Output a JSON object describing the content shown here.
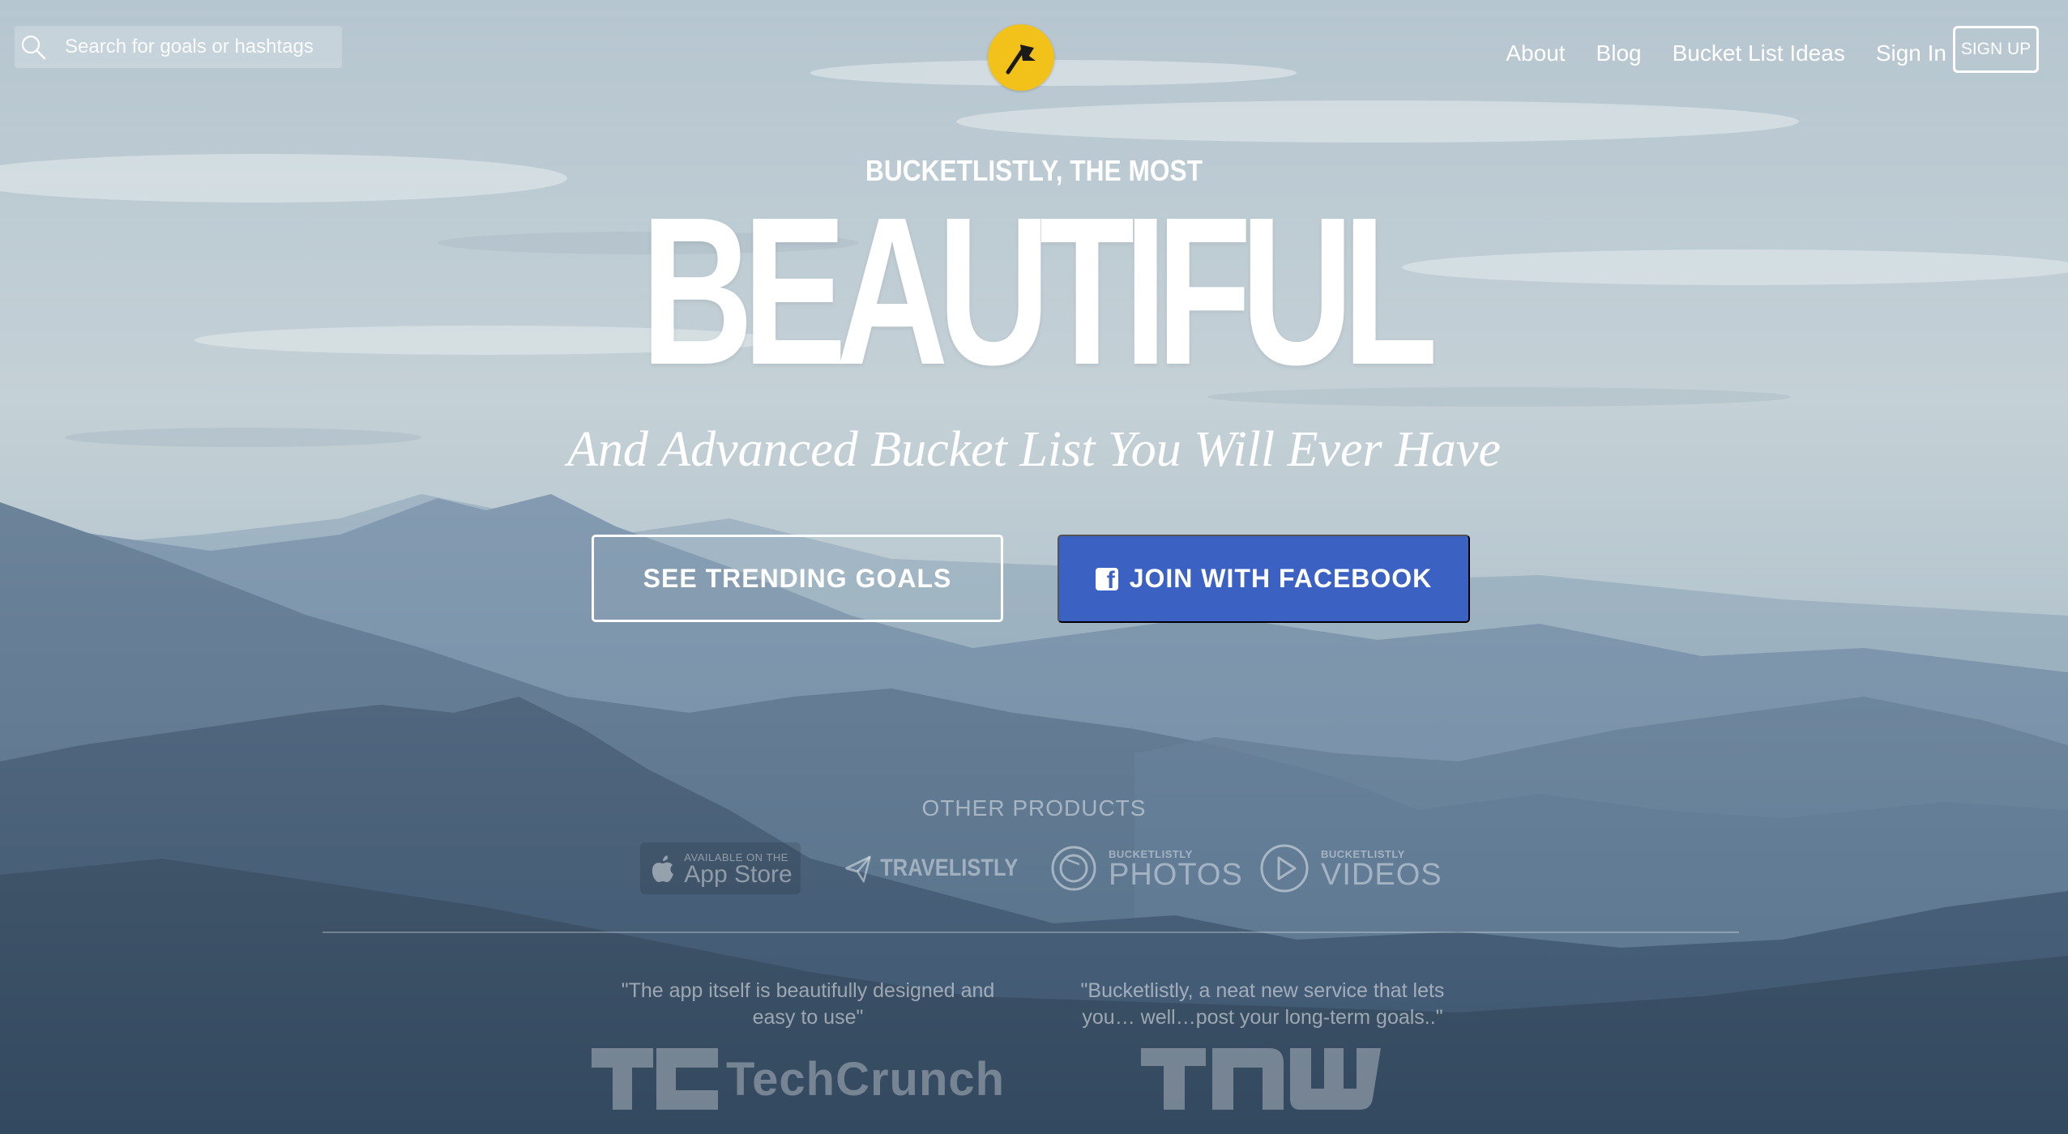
{
  "header": {
    "search_placeholder": "Search for goals or hashtags",
    "nav": [
      "About",
      "Blog",
      "Bucket List Ideas",
      "Sign In"
    ],
    "signup_label": "SIGN UP"
  },
  "hero": {
    "eyebrow": "BUCKETLISTLY, THE MOST",
    "headline": "BEAUTIFUL",
    "tagline": "And Advanced Bucket List You Will Ever Have",
    "trending_button": "SEE TRENDING GOALS",
    "facebook_button": "JOIN WITH FACEBOOK"
  },
  "products": {
    "title": "OTHER PRODUCTS",
    "appstore_small": "AVAILABLE ON THE",
    "appstore_big": "App Store",
    "travelistly": "TRAVELISTLY",
    "photos_small": "BUCKETLISTLY",
    "photos_big": "PHOTOS",
    "videos_small": "BUCKETLISTLY",
    "videos_big": "VIDEOS"
  },
  "press": {
    "quote1": "\"The app itself is beautifully designed and easy to use\"",
    "quote2": "\"Bucketlistly, a neat new service that lets you… well…post your long-term goals..\"",
    "techcrunch": "TechCrunch",
    "tnw": "TNW"
  },
  "colors": {
    "accent": "#f2c21b",
    "facebook": "#3b61c2"
  },
  "icons": [
    "search-icon",
    "flag-icon",
    "facebook-icon",
    "apple-icon",
    "paper-plane-icon",
    "camera-lens-icon",
    "play-icon"
  ]
}
